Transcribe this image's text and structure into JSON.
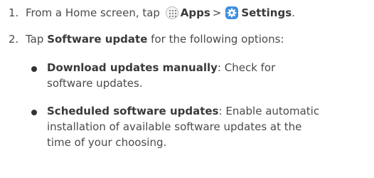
{
  "step1": {
    "number": "1.",
    "text_before": "From a Home screen, tap",
    "apps_icon": "apps-grid-icon",
    "apps_label": "Apps",
    "separator": ">",
    "settings_icon": "gear-icon",
    "settings_label": "Settings",
    "end": "."
  },
  "step2": {
    "number": "2.",
    "text_before": "Tap",
    "bold": "Software update",
    "text_after": "for the following options:"
  },
  "bullets": [
    {
      "title": "Download updates manually",
      "colon": ":",
      "line1": "Check for",
      "line2": "software updates."
    },
    {
      "title": "Scheduled software updates",
      "colon": ":",
      "line1": "Enable automatic",
      "line2": "installation of available software updates at the",
      "line3": "time of your choosing."
    }
  ]
}
